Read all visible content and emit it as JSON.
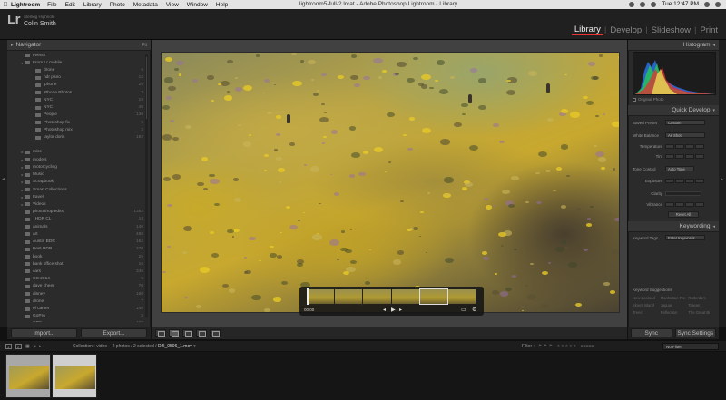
{
  "menubar": {
    "app": "Lightroom",
    "items": [
      "File",
      "Edit",
      "Library",
      "Photo",
      "Metadata",
      "View",
      "Window",
      "Help"
    ],
    "window_title": "lightroom5-full-2.lrcat - Adobe Photoshop Lightroom - Library",
    "clock": "Tue 12:47 PM"
  },
  "identity": {
    "logo": "Lr",
    "small": "Sterling Highnote",
    "name": "Colin Smith"
  },
  "modules": [
    {
      "label": "Library",
      "active": true
    },
    {
      "label": "Develop",
      "active": false
    },
    {
      "label": "Slideshow",
      "active": false
    },
    {
      "label": "Print",
      "active": false
    }
  ],
  "navigator": {
    "title": "Navigator",
    "zoom": "Fit"
  },
  "folders": [
    {
      "name": "events",
      "count": "",
      "level": 1,
      "tw": ""
    },
    {
      "name": "From Lr mobile",
      "count": "",
      "level": 1,
      "tw": "▾"
    },
    {
      "name": "drone",
      "count": "6",
      "level": 2,
      "tw": ""
    },
    {
      "name": "hdr pano",
      "count": "12",
      "level": 2,
      "tw": ""
    },
    {
      "name": "iphone",
      "count": "25",
      "level": 2,
      "tw": ""
    },
    {
      "name": "iPhone Photos",
      "count": "3",
      "level": 2,
      "tw": ""
    },
    {
      "name": "NYC",
      "count": "19",
      "level": 2,
      "tw": ""
    },
    {
      "name": "NYC",
      "count": "46",
      "level": 2,
      "tw": ""
    },
    {
      "name": "People",
      "count": "136",
      "level": 2,
      "tw": ""
    },
    {
      "name": "Photoshop fix",
      "count": "5",
      "level": 2,
      "tw": ""
    },
    {
      "name": "Photoshop mix",
      "count": "2",
      "level": 2,
      "tw": ""
    },
    {
      "name": "taylor doris",
      "count": "192",
      "level": 2,
      "tw": ""
    },
    {
      "name": "",
      "count": "",
      "level": 1,
      "tw": ""
    },
    {
      "name": "misc",
      "count": "",
      "level": 1,
      "tw": "▸"
    },
    {
      "name": "models",
      "count": "",
      "level": 1,
      "tw": "▸"
    },
    {
      "name": "motorcycling",
      "count": "",
      "level": 1,
      "tw": "▸"
    },
    {
      "name": "Music",
      "count": "",
      "level": 1,
      "tw": "▸"
    },
    {
      "name": "Scrapbook",
      "count": "",
      "level": 1,
      "tw": "▸"
    },
    {
      "name": "Smart Collections",
      "count": "",
      "level": 1,
      "tw": "▸"
    },
    {
      "name": "travel",
      "count": "",
      "level": 1,
      "tw": "▸"
    },
    {
      "name": "Videos",
      "count": "",
      "level": 1,
      "tw": "▸"
    },
    {
      "name": "photoshop edits",
      "count": "1352",
      "level": 1,
      "tw": ""
    },
    {
      "name": "_HDR CL",
      "count": "14",
      "level": 1,
      "tw": ""
    },
    {
      "name": "animals",
      "count": "140",
      "level": 1,
      "tw": ""
    },
    {
      "name": "art",
      "count": "486",
      "level": 1,
      "tw": ""
    },
    {
      "name": "Austin BDR",
      "count": "162",
      "level": 1,
      "tw": ""
    },
    {
      "name": "Best HDR",
      "count": "270",
      "level": 1,
      "tw": ""
    },
    {
      "name": "book",
      "count": "25",
      "level": 1,
      "tw": ""
    },
    {
      "name": "bank office shot",
      "count": "16",
      "level": 1,
      "tw": ""
    },
    {
      "name": "cars",
      "count": "345",
      "level": 1,
      "tw": ""
    },
    {
      "name": "CC 2014",
      "count": "5",
      "level": 1,
      "tw": ""
    },
    {
      "name": "dave cheer",
      "count": "70",
      "level": 1,
      "tw": ""
    },
    {
      "name": "disney",
      "count": "160",
      "level": 1,
      "tw": ""
    },
    {
      "name": "drone",
      "count": "7",
      "level": 1,
      "tw": ""
    },
    {
      "name": "el camer",
      "count": "140",
      "level": 1,
      "tw": ""
    },
    {
      "name": "GoPro",
      "count": "5",
      "level": 1,
      "tw": ""
    },
    {
      "name": "GPS",
      "count": "490",
      "level": 1,
      "tw": ""
    },
    {
      "name": "GPSI",
      "count": "482",
      "level": 1,
      "tw": ""
    }
  ],
  "left_buttons": {
    "import": "Import...",
    "export": "Export..."
  },
  "scrubber": {
    "time": "00:00"
  },
  "right_panel": {
    "histogram_title": "Histogram",
    "original_photo": "Original Photo",
    "quick_develop_title": "Quick Develop",
    "saved_preset_label": "Saved Preset",
    "saved_preset_value": "Custom",
    "white_balance_label": "White Balance",
    "white_balance_value": "As Shot",
    "temperature_label": "Temperature",
    "tint_label": "Tint",
    "tone_control_label": "Tone Control",
    "auto_tone": "Auto Tone",
    "exposure_label": "Exposure",
    "clarity_label": "Clarity",
    "vibrance_label": "Vibrance",
    "reset_all": "Reset All",
    "keywording_title": "Keywording",
    "keyword_tags_label": "Keyword Tags",
    "keyword_tags_value": "Enter Keywords",
    "keyword_suggestions_title": "Keyword Suggestions",
    "suggestions": [
      "New Zealand",
      "Manhattan The",
      "Rotterdam",
      "Skiers Island",
      "Jaguar",
      "Taiwan",
      "Trees",
      "Reflection",
      "The Great Bi"
    ]
  },
  "right_buttons": {
    "sync": "Sync",
    "sync_settings": "Sync Settings"
  },
  "filmstrip_bar": {
    "page_numbers": [
      "1",
      "2"
    ],
    "source": "Collection : video",
    "count": "2 photos / 2 selected /",
    "filename": "DJI_0506_1.mov",
    "filter_label": "Filter :",
    "filter_value": "No Filter"
  },
  "colors": {
    "accent_active_module": "#e33333"
  }
}
